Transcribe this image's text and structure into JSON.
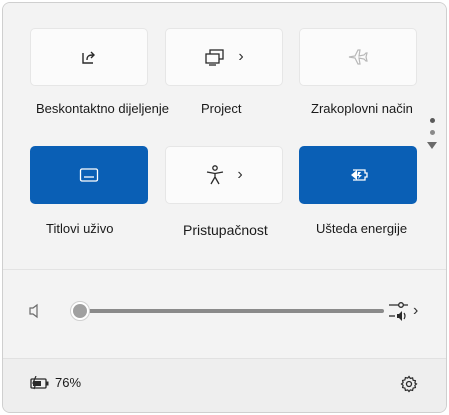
{
  "tiles": [
    {
      "label": "Beskontaktno dijeljenje",
      "icon": "share-icon",
      "state": "off",
      "has_chevron": false
    },
    {
      "label": "Project",
      "icon": "project-icon",
      "state": "off",
      "has_chevron": true
    },
    {
      "label": "Zrakoplovni način",
      "icon": "airplane-icon",
      "state": "disabled",
      "has_chevron": false
    },
    {
      "label": "Titlovi uživo",
      "icon": "captions-icon",
      "state": "on",
      "has_chevron": false
    },
    {
      "label": "Pristupačnost",
      "icon": "accessibility-icon",
      "state": "off",
      "has_chevron": true
    },
    {
      "label": "Ušteda energije",
      "icon": "energy-saver-icon",
      "state": "on",
      "has_chevron": false
    }
  ],
  "pager": {
    "pages": 2,
    "current": 1
  },
  "volume": {
    "icon": "speaker-muted-icon",
    "level": 0
  },
  "audio_output": {
    "icon": "audio-output-icon"
  },
  "footer": {
    "battery_percent": "76%",
    "battery_icon": "battery-charging-icon",
    "settings_icon": "settings-gear-icon"
  },
  "colors": {
    "accent": "#0a5fb5",
    "panel_bg": "#f3f3f3",
    "tile_bg": "#fbfbfb"
  }
}
